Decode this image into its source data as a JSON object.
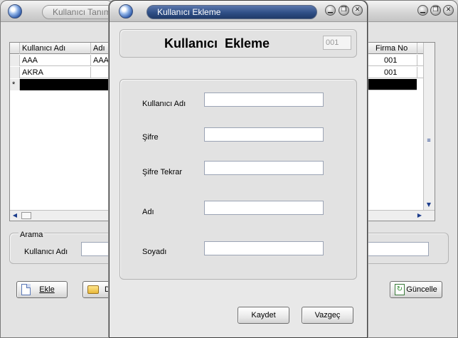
{
  "left_window": {
    "title": "Kullanıcı Tanım",
    "grid_headers": [
      "Kullanıcı Adı",
      "Adı"
    ],
    "rows": [
      {
        "kullanici": "AAA",
        "adi": "AAA"
      },
      {
        "kullanici": "AKRA",
        "adi": ""
      }
    ],
    "new_row_marker": "*",
    "search_group": "Arama",
    "search_label": "Kullanıcı Adı",
    "add_button": "Ekle",
    "edit_button_partial": "D"
  },
  "right_window": {
    "grid_header": "Firma No",
    "rows": [
      "001",
      "001"
    ],
    "update_button": "Güncelle"
  },
  "dialog": {
    "title": "Kullanıcı Ekleme",
    "heading": "Kullanıcı  Ekleme",
    "id_field_value": "001",
    "fields": {
      "username_label": "Kullanıcı Adı",
      "password_label": "Şifre",
      "password_repeat_label": "Şifre Tekrar",
      "name_label": "Adı",
      "surname_label": "Soyadı"
    },
    "save_button": "Kaydet",
    "cancel_button": "Vazgeç"
  },
  "window_controls": {
    "minimize": "▁",
    "restore": "❐",
    "close": "✕"
  },
  "colors": {
    "title_pill": "#2f4f86",
    "dialog_bg": "#e8e8e8",
    "selected_row": "#000000"
  }
}
